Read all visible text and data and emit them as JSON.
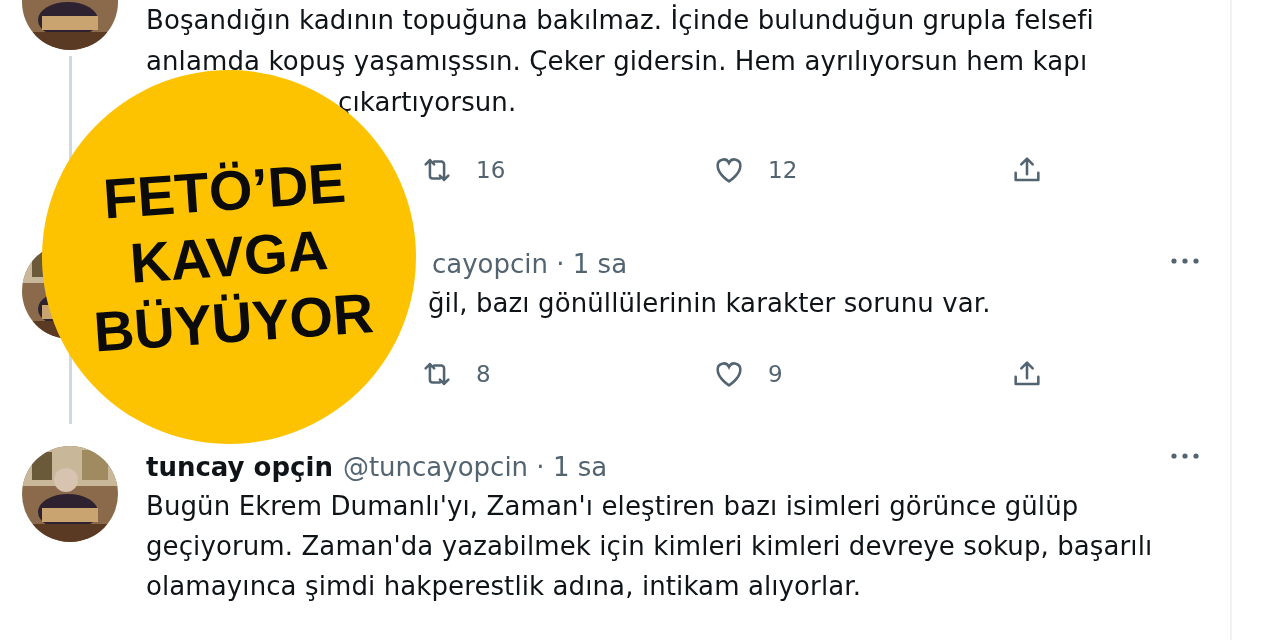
{
  "tweets": [
    {
      "thread_line": true,
      "lines": [
        "Boşandığın kadının topuğuna bakılmaz. İçinde bulunduğun grupla felsefi",
        "anlamda kopuş yaşamışssın. Çeker gidersin. Hem ayrılıyorsun hem kapı",
        "çıkartıyorsun."
      ],
      "actions": [
        {
          "kind": "retweet",
          "count": "16"
        },
        {
          "kind": "like",
          "count": "12"
        },
        {
          "kind": "share"
        }
      ]
    },
    {
      "thread_line": true,
      "more_button": true,
      "meta": "cayopcin · 1 sa",
      "lines": [
        "ğil, bazı gönüllülerinin karakter sorunu var."
      ],
      "actions": [
        {
          "kind": "retweet",
          "count": "8"
        },
        {
          "kind": "like",
          "count": "9"
        },
        {
          "kind": "share"
        }
      ]
    },
    {
      "more_button": true,
      "name": "tuncay opçin",
      "meta": "@tuncayopcin · 1 sa",
      "lines": [
        "Bugün Ekrem Dumanlı'yı, Zaman'ı eleştiren bazı isimleri görünce gülüp",
        "geçiyorum. Zaman'da yazabilmek için kimleri kimleri devreye sokup, başarılı",
        "olamayınca şimdi hakperestlik adına, intikam alıyorlar."
      ]
    }
  ],
  "headline_badge": {
    "lines": [
      "FETÖ’DE",
      "KAVGA",
      "BÜYÜYOR"
    ]
  }
}
